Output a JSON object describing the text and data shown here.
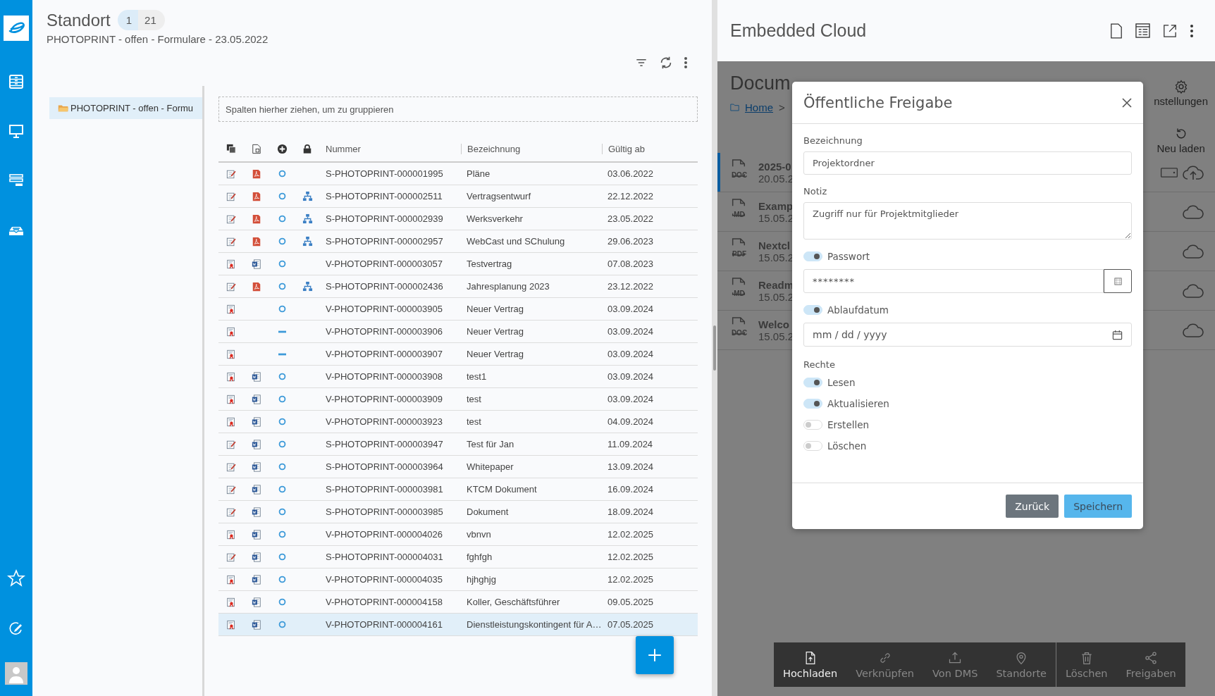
{
  "page": {
    "title": "Standort",
    "badges": [
      {
        "text": "1",
        "active": true
      },
      {
        "text": "21",
        "active": false
      }
    ],
    "subtitle": "PHOTOPRINT - offen - Formulare - 23.05.2022"
  },
  "tree": {
    "items": [
      {
        "label": "PHOTOPRINT - offen - Formu",
        "selected": true
      }
    ]
  },
  "table": {
    "group_hint": "Spalten hierher ziehen, um zu gruppieren",
    "columns": [
      "Nummer",
      "Bezeichnung",
      "Gültig ab"
    ],
    "rows": [
      {
        "icons": [
          {
            "kind": "edit"
          },
          {
            "kind": "pdf"
          },
          {
            "kind": "circle"
          },
          {
            "kind": "empty"
          }
        ],
        "nummer": "S-PHOTOPRINT-000001995",
        "bezeichnung": "Pläne",
        "gueltig_ab": "03.06.2022",
        "selected": false
      },
      {
        "icons": [
          {
            "kind": "edit"
          },
          {
            "kind": "pdf"
          },
          {
            "kind": "circle"
          },
          {
            "kind": "hierarchy"
          }
        ],
        "nummer": "S-PHOTOPRINT-000002511",
        "bezeichnung": "Vertragsentwurf",
        "gueltig_ab": "22.12.2022",
        "selected": false
      },
      {
        "icons": [
          {
            "kind": "edit"
          },
          {
            "kind": "pdf"
          },
          {
            "kind": "circle"
          },
          {
            "kind": "hierarchy"
          }
        ],
        "nummer": "S-PHOTOPRINT-000002939",
        "bezeichnung": "Werksverkehr",
        "gueltig_ab": "23.05.2022",
        "selected": false
      },
      {
        "icons": [
          {
            "kind": "edit"
          },
          {
            "kind": "pdf"
          },
          {
            "kind": "circle"
          },
          {
            "kind": "hierarchy"
          }
        ],
        "nummer": "S-PHOTOPRINT-000002957",
        "bezeichnung": "WebCast und SChulung",
        "gueltig_ab": "29.06.2023",
        "selected": false
      },
      {
        "icons": [
          {
            "kind": "contract"
          },
          {
            "kind": "word"
          },
          {
            "kind": "circle"
          },
          {
            "kind": "empty"
          }
        ],
        "nummer": "V-PHOTOPRINT-000003057",
        "bezeichnung": "Testvertrag",
        "gueltig_ab": "07.08.2023",
        "selected": false
      },
      {
        "icons": [
          {
            "kind": "edit"
          },
          {
            "kind": "pdf"
          },
          {
            "kind": "circle"
          },
          {
            "kind": "hierarchy"
          }
        ],
        "nummer": "S-PHOTOPRINT-000002436",
        "bezeichnung": "Jahresplanung 2023",
        "gueltig_ab": "23.12.2022",
        "selected": false
      },
      {
        "icons": [
          {
            "kind": "contract"
          },
          {
            "kind": "empty"
          },
          {
            "kind": "circle"
          },
          {
            "kind": "empty"
          }
        ],
        "nummer": "V-PHOTOPRINT-000003905",
        "bezeichnung": "Neuer Vertrag",
        "gueltig_ab": "03.09.2024",
        "selected": false
      },
      {
        "icons": [
          {
            "kind": "contract"
          },
          {
            "kind": "empty"
          },
          {
            "kind": "dash"
          },
          {
            "kind": "empty"
          }
        ],
        "nummer": "V-PHOTOPRINT-000003906",
        "bezeichnung": "Neuer Vertrag",
        "gueltig_ab": "03.09.2024",
        "selected": false
      },
      {
        "icons": [
          {
            "kind": "contract"
          },
          {
            "kind": "empty"
          },
          {
            "kind": "dash"
          },
          {
            "kind": "empty"
          }
        ],
        "nummer": "V-PHOTOPRINT-000003907",
        "bezeichnung": "Neuer Vertrag",
        "gueltig_ab": "03.09.2024",
        "selected": false
      },
      {
        "icons": [
          {
            "kind": "contract"
          },
          {
            "kind": "word"
          },
          {
            "kind": "circle"
          },
          {
            "kind": "empty"
          }
        ],
        "nummer": "V-PHOTOPRINT-000003908",
        "bezeichnung": "test1",
        "gueltig_ab": "03.09.2024",
        "selected": false
      },
      {
        "icons": [
          {
            "kind": "contract"
          },
          {
            "kind": "word"
          },
          {
            "kind": "circle"
          },
          {
            "kind": "empty"
          }
        ],
        "nummer": "V-PHOTOPRINT-000003909",
        "bezeichnung": "test",
        "gueltig_ab": "03.09.2024",
        "selected": false
      },
      {
        "icons": [
          {
            "kind": "contract"
          },
          {
            "kind": "word"
          },
          {
            "kind": "circle"
          },
          {
            "kind": "empty"
          }
        ],
        "nummer": "V-PHOTOPRINT-000003923",
        "bezeichnung": "test",
        "gueltig_ab": "04.09.2024",
        "selected": false
      },
      {
        "icons": [
          {
            "kind": "edit"
          },
          {
            "kind": "word"
          },
          {
            "kind": "circle"
          },
          {
            "kind": "empty"
          }
        ],
        "nummer": "S-PHOTOPRINT-000003947",
        "bezeichnung": "Test für Jan",
        "gueltig_ab": "11.09.2024",
        "selected": false
      },
      {
        "icons": [
          {
            "kind": "edit"
          },
          {
            "kind": "word"
          },
          {
            "kind": "circle"
          },
          {
            "kind": "empty"
          }
        ],
        "nummer": "S-PHOTOPRINT-000003964",
        "bezeichnung": "Whitepaper",
        "gueltig_ab": "13.09.2024",
        "selected": false
      },
      {
        "icons": [
          {
            "kind": "edit"
          },
          {
            "kind": "word"
          },
          {
            "kind": "circle"
          },
          {
            "kind": "empty"
          }
        ],
        "nummer": "S-PHOTOPRINT-000003981",
        "bezeichnung": "KTCM Dokument",
        "gueltig_ab": "16.09.2024",
        "selected": false
      },
      {
        "icons": [
          {
            "kind": "edit"
          },
          {
            "kind": "word"
          },
          {
            "kind": "circle"
          },
          {
            "kind": "empty"
          }
        ],
        "nummer": "S-PHOTOPRINT-000003985",
        "bezeichnung": "Dokument",
        "gueltig_ab": "18.09.2024",
        "selected": false
      },
      {
        "icons": [
          {
            "kind": "contract"
          },
          {
            "kind": "word"
          },
          {
            "kind": "circle"
          },
          {
            "kind": "empty"
          }
        ],
        "nummer": "V-PHOTOPRINT-000004026",
        "bezeichnung": "vbnvn",
        "gueltig_ab": "12.02.2025",
        "selected": false
      },
      {
        "icons": [
          {
            "kind": "edit"
          },
          {
            "kind": "word"
          },
          {
            "kind": "circle"
          },
          {
            "kind": "empty"
          }
        ],
        "nummer": "S-PHOTOPRINT-000004031",
        "bezeichnung": "fghfgh",
        "gueltig_ab": "12.02.2025",
        "selected": false
      },
      {
        "icons": [
          {
            "kind": "contract"
          },
          {
            "kind": "word"
          },
          {
            "kind": "circle"
          },
          {
            "kind": "empty"
          }
        ],
        "nummer": "V-PHOTOPRINT-000004035",
        "bezeichnung": "hjhghjg",
        "gueltig_ab": "12.02.2025",
        "selected": false
      },
      {
        "icons": [
          {
            "kind": "contract"
          },
          {
            "kind": "word"
          },
          {
            "kind": "circle"
          },
          {
            "kind": "empty"
          }
        ],
        "nummer": "V-PHOTOPRINT-000004158",
        "bezeichnung": "Koller, Geschäftsführer",
        "gueltig_ab": "09.05.2025",
        "selected": false
      },
      {
        "icons": [
          {
            "kind": "contract"
          },
          {
            "kind": "word"
          },
          {
            "kind": "circle"
          },
          {
            "kind": "empty"
          }
        ],
        "nummer": "V-PHOTOPRINT-000004161",
        "bezeichnung": "Dienstleistungskontingent für A…",
        "gueltig_ab": "07.05.2025",
        "selected": true
      }
    ]
  },
  "cloud": {
    "title": "Embedded Cloud",
    "page_title": "Docum",
    "breadcrumb": [
      "Home",
      ">"
    ],
    "settings_label": "nstellungen",
    "reload_label": "Neu laden",
    "files": [
      {
        "kind": "upload",
        "type_label": "DOC",
        "name": "2025-0",
        "date": "20.05.2",
        "selected": true
      },
      {
        "kind": "plain",
        "type_label": "MD",
        "name": "Examp",
        "date": "15.05.2",
        "selected": false
      },
      {
        "kind": "plain",
        "type_label": "PDF",
        "name": "Nextcl",
        "date": "15.05.2",
        "selected": false
      },
      {
        "kind": "plain",
        "type_label": "MD",
        "name": "Readm",
        "date": "15.05.2",
        "selected": false
      },
      {
        "kind": "plain",
        "type_label": "DOC",
        "name": "Welco",
        "date": "15.05.2",
        "selected": false
      }
    ],
    "toolbar": [
      {
        "label": "Hochladen",
        "disabled": false,
        "separator_before": false
      },
      {
        "label": "Verknüpfen",
        "disabled": true,
        "separator_before": false
      },
      {
        "label": "Von DMS",
        "disabled": true,
        "separator_before": false
      },
      {
        "label": "Standorte",
        "disabled": true,
        "separator_before": false
      },
      {
        "label": "Löschen",
        "disabled": true,
        "separator_before": true
      },
      {
        "label": "Freigaben",
        "disabled": true,
        "separator_before": false
      }
    ]
  },
  "dialog": {
    "title": "Öffentliche Freigabe",
    "name_label": "Bezeichnung",
    "name_value": "Projektordner",
    "note_label": "Notiz",
    "note_value": "Zugriff nur für Projektmitglieder",
    "password": {
      "label": "Passwort",
      "on": true,
      "value": "********"
    },
    "expiry": {
      "label": "Ablaufdatum",
      "on": true,
      "placeholder": "mm / dd / yyyy"
    },
    "rights_label": "Rechte",
    "rights": [
      {
        "label": "Lesen",
        "on": true
      },
      {
        "label": "Aktualisieren",
        "on": true
      },
      {
        "label": "Erstellen",
        "on": false
      },
      {
        "label": "Löschen",
        "on": false
      }
    ],
    "buttons": [
      {
        "label": "Zurück",
        "kind": "secondary"
      },
      {
        "label": "Speichern",
        "kind": "primary"
      }
    ]
  }
}
